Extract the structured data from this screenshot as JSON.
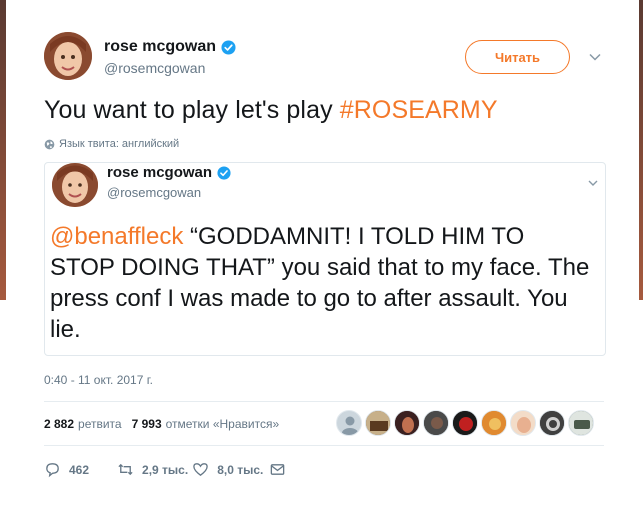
{
  "tweet": {
    "author_name": "rose mcgowan",
    "author_handle": "@rosemcgowan",
    "follow_label": "Читать",
    "text_prefix": "You want to play let's play ",
    "hashtag": "#ROSEARMY",
    "language_note": "Язык твита: английский",
    "timestamp": "0:40 - 11 окт. 2017 г.",
    "retweets_count": "2 882",
    "retweets_label": "ретвита",
    "likes_count": "7 993",
    "likes_label": "отметки «Нравится»"
  },
  "quoted": {
    "author_name": "rose mcgowan",
    "author_handle": "@rosemcgowan",
    "mention": "@benaffleck",
    "text": " “GODDAMNIT! I TOLD HIM TO STOP DOING THAT” you said that to my face. The press conf I was made to go to after assault. You lie."
  },
  "actions": {
    "reply_count": "462",
    "retweet_count": "2,9 тыс.",
    "like_count": "8,0 тыс."
  },
  "colors": {
    "accent": "#f4792a",
    "verified": "#1da1f2",
    "muted": "#657786"
  },
  "icons": [
    "verified-icon",
    "chevron-down-icon",
    "globe-icon",
    "reply-icon",
    "retweet-icon",
    "heart-icon",
    "envelope-icon"
  ]
}
